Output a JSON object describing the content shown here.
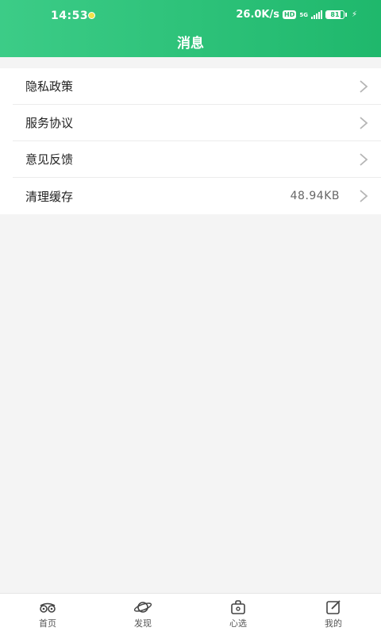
{
  "status_bar": {
    "time": "14:53",
    "speed": "26.0K/s",
    "hd": "HD",
    "network": "5G",
    "battery": "81",
    "battery_level": 0.81
  },
  "header": {
    "title": "消息"
  },
  "settings": [
    {
      "label": "隐私政策",
      "value": ""
    },
    {
      "label": "服务协议",
      "value": ""
    },
    {
      "label": "意见反馈",
      "value": ""
    },
    {
      "label": "清理缓存",
      "value": "48.94KB"
    }
  ],
  "bottom_nav": [
    {
      "label": "首页",
      "icon": "home-binoculars-icon"
    },
    {
      "label": "发现",
      "icon": "discover-planet-icon"
    },
    {
      "label": "心选",
      "icon": "shop-bag-icon"
    },
    {
      "label": "我的",
      "icon": "edit-profile-icon"
    }
  ],
  "colors": {
    "accent_start": "#3ccc87",
    "accent_end": "#1fb86c"
  }
}
